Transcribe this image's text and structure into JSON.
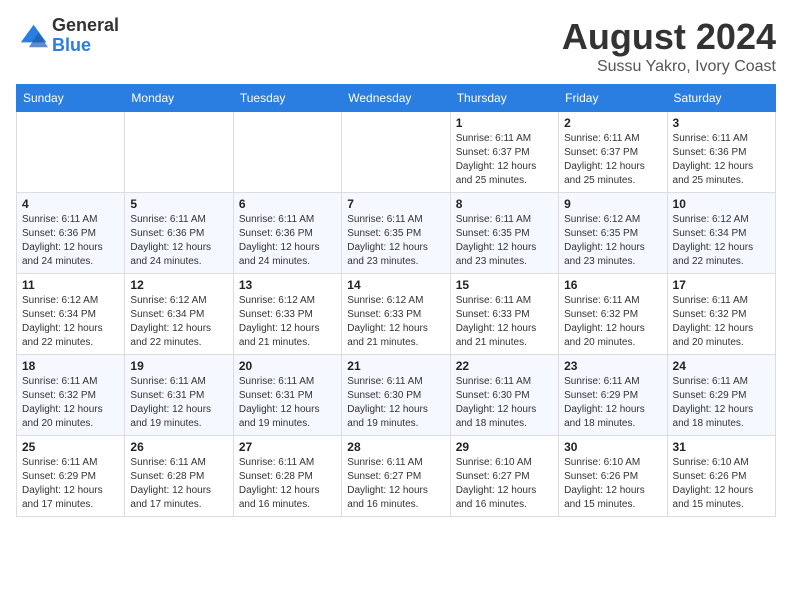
{
  "header": {
    "logo_line1": "General",
    "logo_line2": "Blue",
    "month_year": "August 2024",
    "location": "Sussu Yakro, Ivory Coast"
  },
  "weekdays": [
    "Sunday",
    "Monday",
    "Tuesday",
    "Wednesday",
    "Thursday",
    "Friday",
    "Saturday"
  ],
  "weeks": [
    [
      {
        "day": "",
        "info": ""
      },
      {
        "day": "",
        "info": ""
      },
      {
        "day": "",
        "info": ""
      },
      {
        "day": "",
        "info": ""
      },
      {
        "day": "1",
        "info": "Sunrise: 6:11 AM\nSunset: 6:37 PM\nDaylight: 12 hours\nand 25 minutes."
      },
      {
        "day": "2",
        "info": "Sunrise: 6:11 AM\nSunset: 6:37 PM\nDaylight: 12 hours\nand 25 minutes."
      },
      {
        "day": "3",
        "info": "Sunrise: 6:11 AM\nSunset: 6:36 PM\nDaylight: 12 hours\nand 25 minutes."
      }
    ],
    [
      {
        "day": "4",
        "info": "Sunrise: 6:11 AM\nSunset: 6:36 PM\nDaylight: 12 hours\nand 24 minutes."
      },
      {
        "day": "5",
        "info": "Sunrise: 6:11 AM\nSunset: 6:36 PM\nDaylight: 12 hours\nand 24 minutes."
      },
      {
        "day": "6",
        "info": "Sunrise: 6:11 AM\nSunset: 6:36 PM\nDaylight: 12 hours\nand 24 minutes."
      },
      {
        "day": "7",
        "info": "Sunrise: 6:11 AM\nSunset: 6:35 PM\nDaylight: 12 hours\nand 23 minutes."
      },
      {
        "day": "8",
        "info": "Sunrise: 6:11 AM\nSunset: 6:35 PM\nDaylight: 12 hours\nand 23 minutes."
      },
      {
        "day": "9",
        "info": "Sunrise: 6:12 AM\nSunset: 6:35 PM\nDaylight: 12 hours\nand 23 minutes."
      },
      {
        "day": "10",
        "info": "Sunrise: 6:12 AM\nSunset: 6:34 PM\nDaylight: 12 hours\nand 22 minutes."
      }
    ],
    [
      {
        "day": "11",
        "info": "Sunrise: 6:12 AM\nSunset: 6:34 PM\nDaylight: 12 hours\nand 22 minutes."
      },
      {
        "day": "12",
        "info": "Sunrise: 6:12 AM\nSunset: 6:34 PM\nDaylight: 12 hours\nand 22 minutes."
      },
      {
        "day": "13",
        "info": "Sunrise: 6:12 AM\nSunset: 6:33 PM\nDaylight: 12 hours\nand 21 minutes."
      },
      {
        "day": "14",
        "info": "Sunrise: 6:12 AM\nSunset: 6:33 PM\nDaylight: 12 hours\nand 21 minutes."
      },
      {
        "day": "15",
        "info": "Sunrise: 6:11 AM\nSunset: 6:33 PM\nDaylight: 12 hours\nand 21 minutes."
      },
      {
        "day": "16",
        "info": "Sunrise: 6:11 AM\nSunset: 6:32 PM\nDaylight: 12 hours\nand 20 minutes."
      },
      {
        "day": "17",
        "info": "Sunrise: 6:11 AM\nSunset: 6:32 PM\nDaylight: 12 hours\nand 20 minutes."
      }
    ],
    [
      {
        "day": "18",
        "info": "Sunrise: 6:11 AM\nSunset: 6:32 PM\nDaylight: 12 hours\nand 20 minutes."
      },
      {
        "day": "19",
        "info": "Sunrise: 6:11 AM\nSunset: 6:31 PM\nDaylight: 12 hours\nand 19 minutes."
      },
      {
        "day": "20",
        "info": "Sunrise: 6:11 AM\nSunset: 6:31 PM\nDaylight: 12 hours\nand 19 minutes."
      },
      {
        "day": "21",
        "info": "Sunrise: 6:11 AM\nSunset: 6:30 PM\nDaylight: 12 hours\nand 19 minutes."
      },
      {
        "day": "22",
        "info": "Sunrise: 6:11 AM\nSunset: 6:30 PM\nDaylight: 12 hours\nand 18 minutes."
      },
      {
        "day": "23",
        "info": "Sunrise: 6:11 AM\nSunset: 6:29 PM\nDaylight: 12 hours\nand 18 minutes."
      },
      {
        "day": "24",
        "info": "Sunrise: 6:11 AM\nSunset: 6:29 PM\nDaylight: 12 hours\nand 18 minutes."
      }
    ],
    [
      {
        "day": "25",
        "info": "Sunrise: 6:11 AM\nSunset: 6:29 PM\nDaylight: 12 hours\nand 17 minutes."
      },
      {
        "day": "26",
        "info": "Sunrise: 6:11 AM\nSunset: 6:28 PM\nDaylight: 12 hours\nand 17 minutes."
      },
      {
        "day": "27",
        "info": "Sunrise: 6:11 AM\nSunset: 6:28 PM\nDaylight: 12 hours\nand 16 minutes."
      },
      {
        "day": "28",
        "info": "Sunrise: 6:11 AM\nSunset: 6:27 PM\nDaylight: 12 hours\nand 16 minutes."
      },
      {
        "day": "29",
        "info": "Sunrise: 6:10 AM\nSunset: 6:27 PM\nDaylight: 12 hours\nand 16 minutes."
      },
      {
        "day": "30",
        "info": "Sunrise: 6:10 AM\nSunset: 6:26 PM\nDaylight: 12 hours\nand 15 minutes."
      },
      {
        "day": "31",
        "info": "Sunrise: 6:10 AM\nSunset: 6:26 PM\nDaylight: 12 hours\nand 15 minutes."
      }
    ]
  ]
}
